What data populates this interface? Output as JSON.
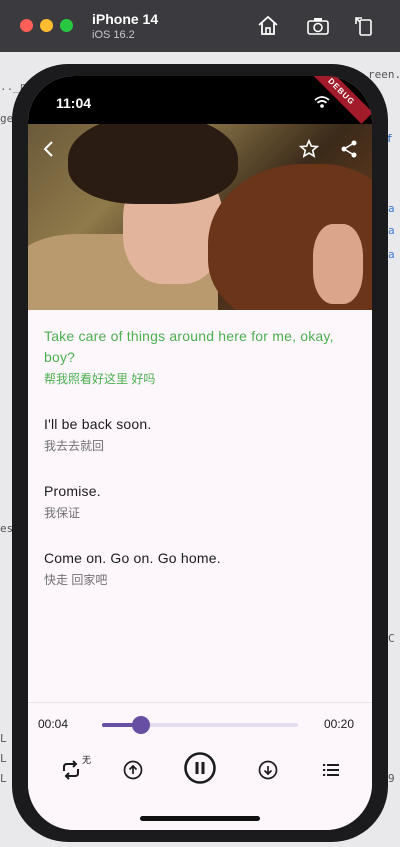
{
  "simulator": {
    "device": "iPhone 14",
    "os": "iOS 16.2",
    "icons": [
      "home-icon",
      "screenshot-icon",
      "rotate-icon"
    ]
  },
  "status_bar": {
    "time": "11:04",
    "debug_banner": "DEBUG"
  },
  "header": {
    "icons": [
      "back-icon",
      "star-icon",
      "share-icon"
    ]
  },
  "subtitles": [
    {
      "en": "Take care of things around here for me, okay, boy?",
      "zh": "帮我照看好这里 好吗",
      "active": true
    },
    {
      "en": "I'll be back soon.",
      "zh": "我去去就回",
      "active": false
    },
    {
      "en": "Promise.",
      "zh": "我保证",
      "active": false
    },
    {
      "en": "Come on. Go on. Go home.",
      "zh": "快走 回家吧",
      "active": false
    }
  ],
  "player": {
    "current_time": "00:04",
    "duration": "00:20",
    "progress_fraction": 0.2,
    "loop_mode_label": "无",
    "controls": [
      "loop-icon",
      "previous-icon",
      "pause-icon",
      "next-icon",
      "list-icon"
    ]
  },
  "colors": {
    "active_text": "#4caf50",
    "accent": "#6750a4",
    "debug_banner": "#a11b2a"
  }
}
